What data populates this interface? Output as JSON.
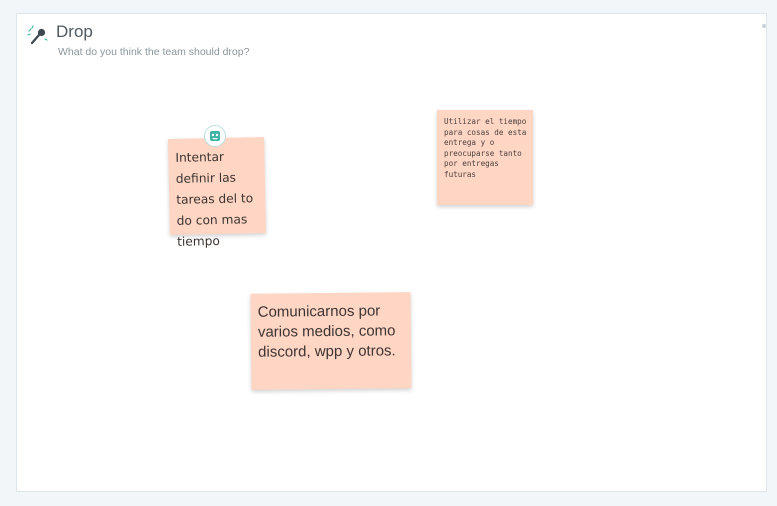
{
  "section": {
    "title": "Drop",
    "subtitle": "What do you think the team should drop?",
    "icon": "microphone-drop-icon"
  },
  "notes": [
    {
      "text": "Intentar definir las tareas del to do con mas tiempo",
      "color": "#ffd5c3",
      "author_icon": "avatar-icon"
    },
    {
      "text": "Utilizar el tiempo para cosas de esta entrega y o preocuparse tanto por entregas futuras",
      "color": "#ffd5c3"
    },
    {
      "text": "Comunicarnos por varios medios, como discord, wpp y otros.",
      "color": "#ffd5c3"
    }
  ],
  "colors": {
    "background": "#f3f6f8",
    "board": "#ffffff",
    "note": "#ffd5c3",
    "avatar_accent": "#3fb3a4"
  }
}
